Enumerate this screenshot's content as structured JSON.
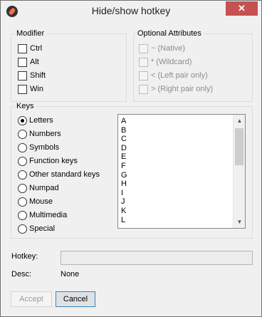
{
  "window": {
    "title": "Hide/show hotkey",
    "close_glyph": "✕"
  },
  "modifier": {
    "legend": "Modifier",
    "items": [
      {
        "label": "Ctrl",
        "checked": false
      },
      {
        "label": "Alt",
        "checked": false
      },
      {
        "label": "Shift",
        "checked": false
      },
      {
        "label": "Win",
        "checked": false
      }
    ]
  },
  "optional": {
    "legend": "Optional Attributes",
    "items": [
      {
        "label": "~ (Native)",
        "checked": false,
        "enabled": false
      },
      {
        "label": "* (Wildcard)",
        "checked": false,
        "enabled": false
      },
      {
        "label": "< (Left pair only)",
        "checked": false,
        "enabled": false
      },
      {
        "label": "> (Right pair only)",
        "checked": false,
        "enabled": false
      }
    ]
  },
  "keys": {
    "legend": "Keys",
    "radios": [
      {
        "label": "Letters",
        "selected": true
      },
      {
        "label": "Numbers",
        "selected": false
      },
      {
        "label": "Symbols",
        "selected": false
      },
      {
        "label": "Function keys",
        "selected": false
      },
      {
        "label": "Other standard keys",
        "selected": false
      },
      {
        "label": "Numpad",
        "selected": false
      },
      {
        "label": "Mouse",
        "selected": false
      },
      {
        "label": "Multimedia",
        "selected": false
      },
      {
        "label": "Special",
        "selected": false
      }
    ],
    "list": [
      "A",
      "B",
      "C",
      "D",
      "E",
      "F",
      "G",
      "H",
      "I",
      "J",
      "K",
      "L"
    ]
  },
  "hotkey": {
    "label": "Hotkey:",
    "value": ""
  },
  "desc": {
    "label": "Desc:",
    "value": "None"
  },
  "buttons": {
    "accept": "Accept",
    "cancel": "Cancel"
  }
}
